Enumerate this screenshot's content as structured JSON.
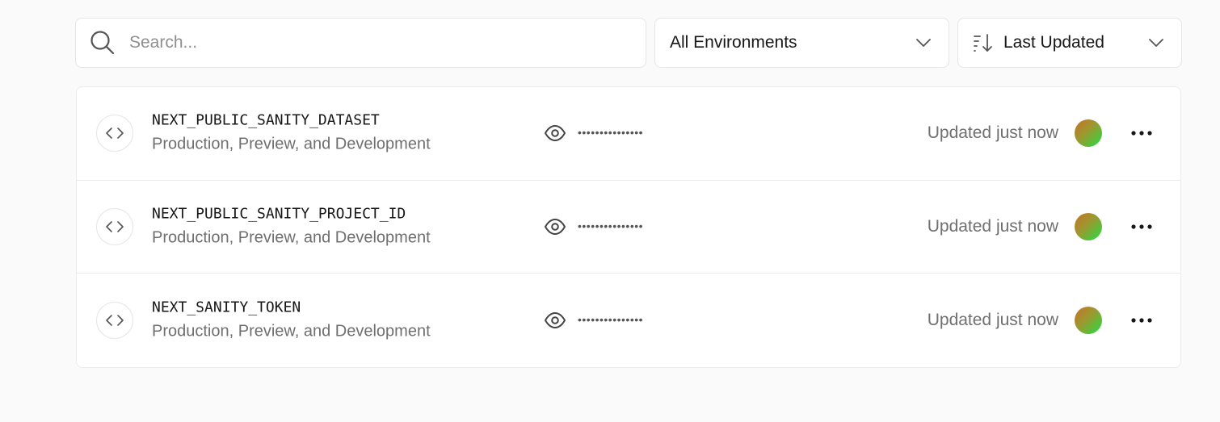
{
  "search": {
    "placeholder": "Search..."
  },
  "filters": {
    "environment": {
      "selected": "All Environments"
    },
    "sort": {
      "selected": "Last Updated"
    }
  },
  "variables": [
    {
      "name": "NEXT_PUBLIC_SANITY_DATASET",
      "environments": "Production, Preview, and Development",
      "masked_value": "•••••••••••••••",
      "updated": "Updated just now"
    },
    {
      "name": "NEXT_PUBLIC_SANITY_PROJECT_ID",
      "environments": "Production, Preview, and Development",
      "masked_value": "•••••••••••••••",
      "updated": "Updated just now"
    },
    {
      "name": "NEXT_SANITY_TOKEN",
      "environments": "Production, Preview, and Development",
      "masked_value": "•••••••••••••••",
      "updated": "Updated just now"
    }
  ],
  "icons": {
    "search": "search-icon",
    "sort": "sort-descending-icon",
    "chevron": "chevron-down-icon",
    "code": "code-brackets-icon",
    "reveal": "eye-icon",
    "more": "more-horizontal-icon"
  },
  "colors": {
    "background": "#fafafa",
    "card": "#ffffff",
    "border": "#ebebeb",
    "muted_text": "#6f6f6f"
  }
}
